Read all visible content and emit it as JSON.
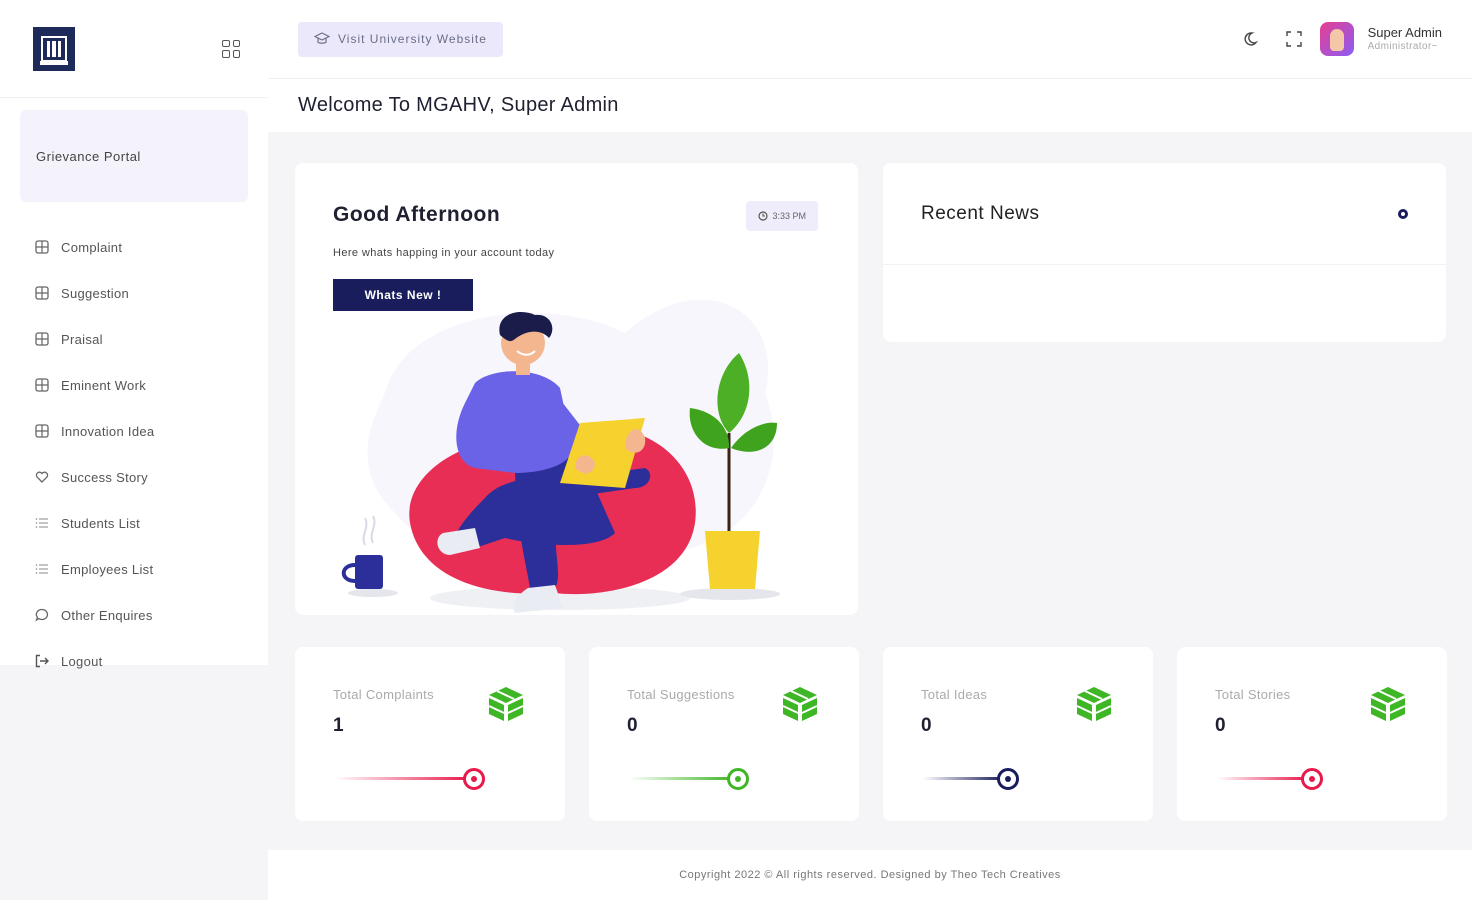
{
  "sidebar": {
    "portal_label": "Grievance Portal",
    "items": [
      {
        "label": "Complaint",
        "icon": "layers-icon"
      },
      {
        "label": "Suggestion",
        "icon": "layers-icon"
      },
      {
        "label": "Praisal",
        "icon": "layers-icon"
      },
      {
        "label": "Eminent Work",
        "icon": "layers-icon"
      },
      {
        "label": "Innovation Idea",
        "icon": "layers-icon"
      },
      {
        "label": "Success Story",
        "icon": "heart-icon"
      },
      {
        "label": "Students List",
        "icon": "list-icon"
      },
      {
        "label": "Employees List",
        "icon": "list-icon"
      },
      {
        "label": "Other Enquires",
        "icon": "chat-icon"
      },
      {
        "label": "Logout",
        "icon": "logout-icon"
      }
    ]
  },
  "topbar": {
    "visit_label": "Visit University Website",
    "user_name": "Super Admin",
    "user_role": "Administrator~"
  },
  "welcome": "Welcome To MGAHV, Super Admin",
  "greeting": {
    "title": "Good Afternoon",
    "time": "3:33 PM",
    "subtitle": "Here whats happing in your account today",
    "button": "Whats New !"
  },
  "news": {
    "title": "Recent News"
  },
  "stats": [
    {
      "label": "Total Complaints",
      "value": "1",
      "color": "#e8194b"
    },
    {
      "label": "Total Suggestions",
      "value": "0",
      "color": "#3fb626"
    },
    {
      "label": "Total Ideas",
      "value": "0",
      "color": "#1a1d5c"
    },
    {
      "label": "Total Stories",
      "value": "0",
      "color": "#e8194b"
    }
  ],
  "footer": "Copyright 2022 © All rights reserved. Designed by Theo Tech Creatives",
  "colors": {
    "accent": "#1a1d5c",
    "stat_icon": "#3fb626"
  }
}
